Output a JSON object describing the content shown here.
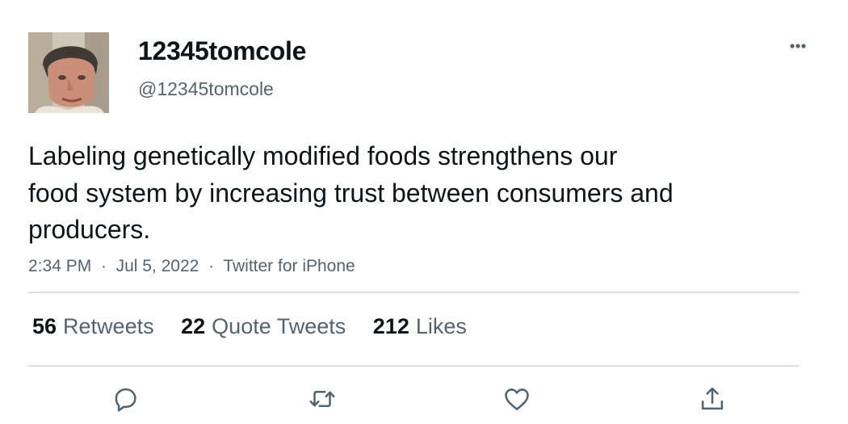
{
  "author": {
    "display_name": "12345tomcole",
    "handle": "@12345tomcole",
    "avatar_icon": "profile-photo"
  },
  "tweet": {
    "text_lines": [
      "Labeling genetically modified foods strengthens our",
      "food system by increasing trust between consumers and",
      "producers."
    ],
    "time": "2:34 PM",
    "date": "Jul 5, 2022",
    "source": "Twitter for iPhone",
    "separator": "·"
  },
  "stats": {
    "retweets_count": "56",
    "retweets_label": "Retweets",
    "quote_count": "22",
    "quote_label": "Quote Tweets",
    "likes_count": "212",
    "likes_label": "Likes"
  },
  "actions": {
    "reply_icon": "reply-icon",
    "retweet_icon": "retweet-icon",
    "like_icon": "heart-icon",
    "share_icon": "share-icon",
    "more_icon": "more-icon"
  },
  "colors": {
    "text_primary": "#0f1419",
    "text_secondary": "#536471",
    "divider": "#dcdfe2"
  }
}
